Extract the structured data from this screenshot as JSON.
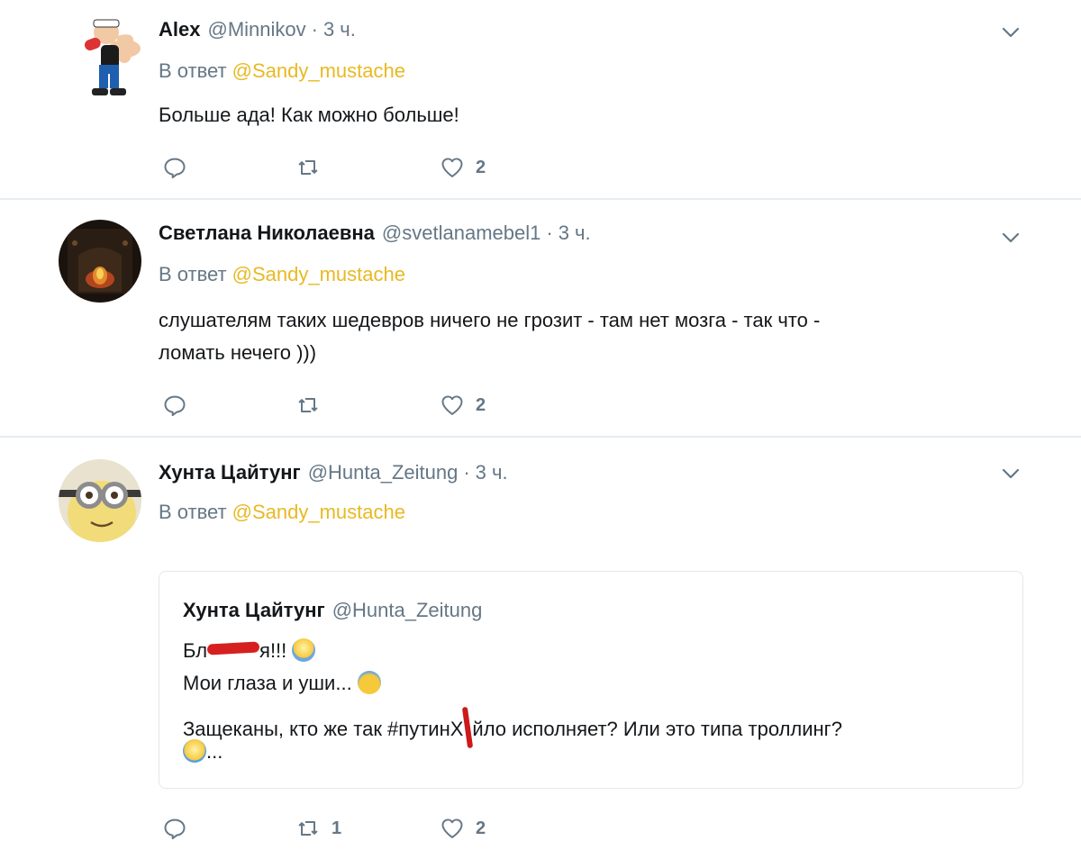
{
  "tweets": [
    {
      "name": "Alex",
      "handle": "@Minnikov",
      "dot": "·",
      "time": "3 ч.",
      "reply_prefix": "В ответ",
      "reply_mention": "@Sandy_mustache",
      "text_lines": [
        "Больше ада! Как можно больше!"
      ],
      "reply_count": "",
      "retweet_count": "",
      "like_count": "2"
    },
    {
      "name": "Светлана Николаевна",
      "handle": "@svetlanamebel1",
      "dot": "·",
      "time": "3 ч.",
      "reply_prefix": "В ответ",
      "reply_mention": "@Sandy_mustache",
      "text_lines": [
        "слушателям таких шедевров ничего не грозит - там нет мозга - так что -",
        "ломать нечего )))"
      ],
      "reply_count": "",
      "retweet_count": "",
      "like_count": "2"
    },
    {
      "name": "Хунта Цайтунг",
      "handle": "@Hunta_Zeitung",
      "dot": "·",
      "time": "3 ч.",
      "reply_prefix": "В ответ",
      "reply_mention": "@Sandy_mustache",
      "reply_count": "",
      "retweet_count": "1",
      "like_count": "2",
      "quote": {
        "name": "Хунта Цайтунг",
        "handle": "@Hunta_Zeitung",
        "line1_start": "Бл",
        "line1_end": "я!!!",
        "line2": "Мои глаза и уши...",
        "line3_start": "Защеканы, кто же так #путинХ",
        "line3_end": "йло исполняет? Или это типа троллинг?",
        "line4": "..."
      }
    }
  ],
  "colors": {
    "mention": "#e8b923",
    "secondary_text": "#657786",
    "divider": "#e6ecf0"
  }
}
